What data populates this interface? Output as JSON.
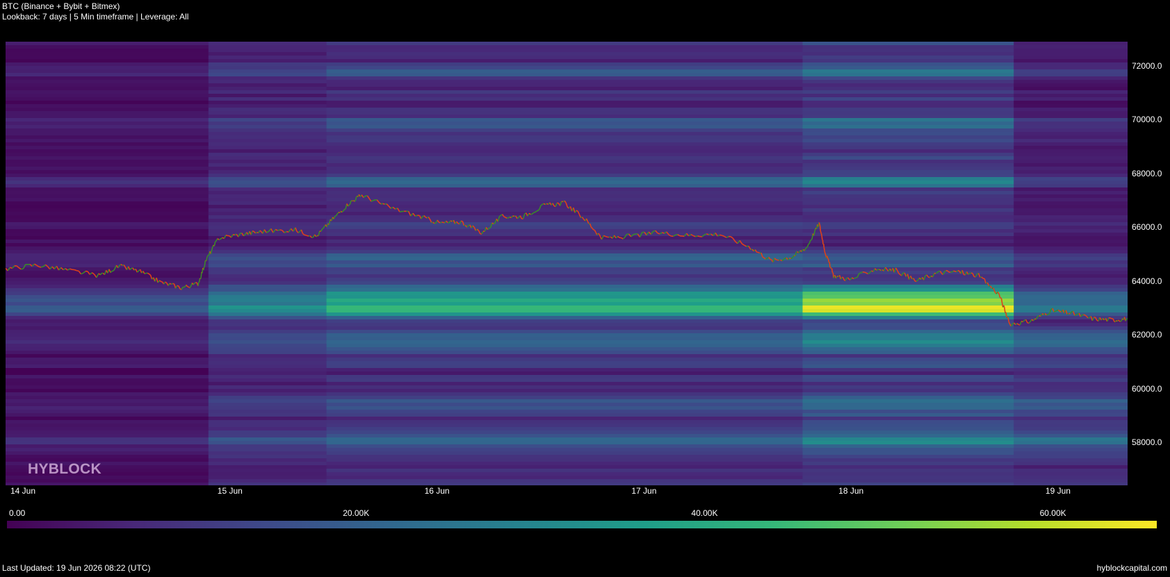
{
  "header": {
    "title": "BTC (Binance + Bybit + Bitmex)",
    "subtitle": "Lookback: 7 days | 5 Min timeframe | Leverage: All"
  },
  "watermark": "HYBLOCK",
  "footer": {
    "last_updated": "Last Updated: 19 Jun 2026 08:22 (UTC)",
    "site": "hyblockcapital.com"
  },
  "colors": {
    "background": "#000000",
    "candle_up": "#3a8a2a",
    "candle_down": "#e0401a",
    "colormap": [
      "#440154",
      "#482878",
      "#3e4989",
      "#31688e",
      "#26828e",
      "#1f9e89",
      "#35b779",
      "#6ece58",
      "#b5de2b",
      "#fde725"
    ]
  },
  "chart_data": {
    "type": "heatmap",
    "x_axis": {
      "min": 0.0,
      "max": 5.42,
      "unit": "days since 14 Jun",
      "tick_labels": [
        "14 Jun",
        "15 Jun",
        "16 Jun",
        "17 Jun",
        "18 Jun",
        "19 Jun"
      ],
      "tick_values": [
        0,
        1,
        2,
        3,
        4,
        5
      ]
    },
    "y_axis": {
      "min": 56400,
      "max": 72900,
      "position": "right",
      "tick_labels": [
        "58000.0",
        "60000.0",
        "62000.0",
        "64000.0",
        "66000.0",
        "68000.0",
        "70000.0",
        "72000.0"
      ],
      "tick_values": [
        58000,
        60000,
        62000,
        64000,
        66000,
        68000,
        70000,
        72000
      ]
    },
    "colorbar": {
      "min": 0,
      "max": 66000,
      "tick_labels": [
        "0.00",
        "20.00K",
        "40.00K",
        "60.00K"
      ],
      "tick_values": [
        0,
        20000,
        40000,
        60000
      ]
    },
    "price_series": {
      "name": "BTC",
      "points": [
        [
          0.0,
          64450
        ],
        [
          0.15,
          64600
        ],
        [
          0.3,
          64400
        ],
        [
          0.45,
          64200
        ],
        [
          0.55,
          64550
        ],
        [
          0.65,
          64350
        ],
        [
          0.75,
          63950
        ],
        [
          0.85,
          63750
        ],
        [
          0.93,
          63900
        ],
        [
          0.97,
          64800
        ],
        [
          1.03,
          65600
        ],
        [
          1.15,
          65750
        ],
        [
          1.25,
          65850
        ],
        [
          1.4,
          65900
        ],
        [
          1.5,
          65650
        ],
        [
          1.58,
          66300
        ],
        [
          1.66,
          66900
        ],
        [
          1.72,
          67200
        ],
        [
          1.85,
          66750
        ],
        [
          2.0,
          66400
        ],
        [
          2.1,
          66150
        ],
        [
          2.2,
          66200
        ],
        [
          2.3,
          65800
        ],
        [
          2.4,
          66400
        ],
        [
          2.5,
          66400
        ],
        [
          2.6,
          66800
        ],
        [
          2.7,
          66900
        ],
        [
          2.8,
          66300
        ],
        [
          2.88,
          65600
        ],
        [
          3.0,
          65650
        ],
        [
          3.15,
          65800
        ],
        [
          3.3,
          65700
        ],
        [
          3.45,
          65750
        ],
        [
          3.6,
          65250
        ],
        [
          3.7,
          64750
        ],
        [
          3.8,
          64900
        ],
        [
          3.87,
          65250
        ],
        [
          3.93,
          66150
        ],
        [
          3.96,
          65050
        ],
        [
          4.0,
          64200
        ],
        [
          4.08,
          64050
        ],
        [
          4.2,
          64450
        ],
        [
          4.3,
          64400
        ],
        [
          4.4,
          64000
        ],
        [
          4.5,
          64300
        ],
        [
          4.6,
          64350
        ],
        [
          4.7,
          64200
        ],
        [
          4.8,
          63500
        ],
        [
          4.85,
          62400
        ],
        [
          4.95,
          62500
        ],
        [
          5.05,
          62900
        ],
        [
          5.15,
          62800
        ],
        [
          5.25,
          62600
        ],
        [
          5.35,
          62550
        ],
        [
          5.42,
          62600
        ]
      ]
    }
  }
}
